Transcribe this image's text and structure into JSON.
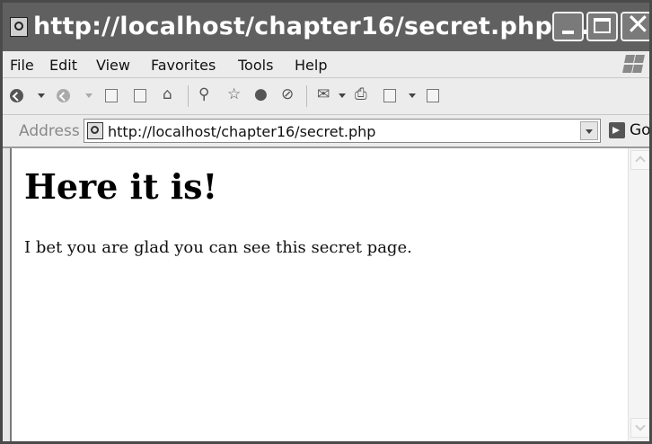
{
  "window": {
    "title": "http://localhost/chapter16/secret.php ..."
  },
  "menu": {
    "items": [
      "File",
      "Edit",
      "View",
      "Favorites",
      "Tools",
      "Help"
    ]
  },
  "address": {
    "label": "Address",
    "url": "http://localhost/chapter16/secret.php",
    "go_label": "Go"
  },
  "page": {
    "heading": "Here it is!",
    "text": "I bet you are glad you can see this secret page."
  },
  "icons": {
    "toolbar": [
      "back-icon",
      "forward-icon",
      "stop-icon",
      "refresh-icon",
      "home-icon",
      "search-icon",
      "favorites-icon",
      "media-icon",
      "history-icon",
      "mail-icon",
      "print-icon",
      "edit-icon",
      "discuss-icon"
    ]
  }
}
